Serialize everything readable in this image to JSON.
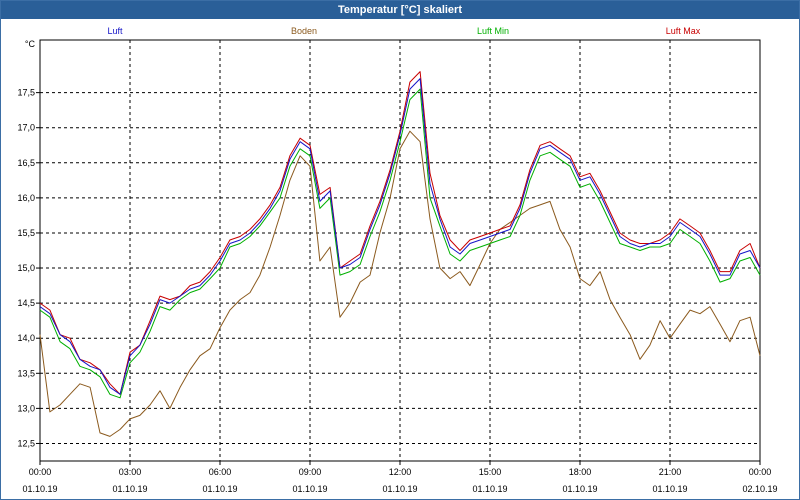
{
  "window": {
    "title": "Temperatur [°C] skaliert"
  },
  "colors": {
    "luft": "#1515c8",
    "boden": "#8b5a1e",
    "luft_min": "#00b000",
    "luft_max": "#c80000",
    "titlebar": "#2a5f98"
  },
  "chart_data": {
    "type": "line",
    "title": "Temperatur [°C] skaliert",
    "ylabel": "°C",
    "xlabel": "",
    "ylim": [
      12.25,
      18.25
    ],
    "yticks": [
      12.5,
      13.0,
      13.5,
      14.0,
      14.5,
      15.0,
      15.5,
      16.0,
      16.5,
      17.0,
      17.5
    ],
    "xlim": [
      0,
      24
    ],
    "xticks": [
      {
        "x": 0,
        "time": "00:00",
        "date": "01.10.19"
      },
      {
        "x": 3,
        "time": "03:00",
        "date": "01.10.19"
      },
      {
        "x": 6,
        "time": "06:00",
        "date": "01.10.19"
      },
      {
        "x": 9,
        "time": "09:00",
        "date": "01.10.19"
      },
      {
        "x": 12,
        "time": "12:00",
        "date": "01.10.19"
      },
      {
        "x": 15,
        "time": "15:00",
        "date": "01.10.19"
      },
      {
        "x": 18,
        "time": "18:00",
        "date": "01.10.19"
      },
      {
        "x": 21,
        "time": "21:00",
        "date": "01.10.19"
      },
      {
        "x": 24,
        "time": "00:00",
        "date": "02.10.19"
      }
    ],
    "grid": true,
    "legend_position": "top",
    "series": [
      {
        "name": "Luft",
        "color_key": "luft",
        "points": [
          [
            0,
            14.45
          ],
          [
            0.33,
            14.35
          ],
          [
            0.67,
            14.05
          ],
          [
            1.0,
            13.95
          ],
          [
            1.33,
            13.7
          ],
          [
            1.67,
            13.6
          ],
          [
            2.0,
            13.55
          ],
          [
            2.33,
            13.3
          ],
          [
            2.67,
            13.2
          ],
          [
            3.0,
            13.75
          ],
          [
            3.33,
            13.9
          ],
          [
            3.67,
            14.2
          ],
          [
            4.0,
            14.55
          ],
          [
            4.33,
            14.5
          ],
          [
            4.67,
            14.6
          ],
          [
            5.0,
            14.7
          ],
          [
            5.33,
            14.75
          ],
          [
            5.67,
            14.9
          ],
          [
            6.0,
            15.1
          ],
          [
            6.33,
            15.35
          ],
          [
            6.67,
            15.4
          ],
          [
            7.0,
            15.5
          ],
          [
            7.33,
            15.65
          ],
          [
            7.67,
            15.85
          ],
          [
            8.0,
            16.1
          ],
          [
            8.33,
            16.55
          ],
          [
            8.67,
            16.8
          ],
          [
            9.0,
            16.7
          ],
          [
            9.33,
            15.95
          ],
          [
            9.67,
            16.1
          ],
          [
            10.0,
            15.0
          ],
          [
            10.33,
            15.05
          ],
          [
            10.67,
            15.15
          ],
          [
            11.0,
            15.55
          ],
          [
            11.33,
            15.9
          ],
          [
            11.67,
            16.35
          ],
          [
            12.0,
            16.9
          ],
          [
            12.33,
            17.55
          ],
          [
            12.67,
            17.7
          ],
          [
            13.0,
            16.2
          ],
          [
            13.33,
            15.7
          ],
          [
            13.67,
            15.3
          ],
          [
            14.0,
            15.2
          ],
          [
            14.33,
            15.35
          ],
          [
            14.67,
            15.4
          ],
          [
            15.0,
            15.45
          ],
          [
            15.33,
            15.5
          ],
          [
            15.67,
            15.55
          ],
          [
            16.0,
            15.85
          ],
          [
            16.33,
            16.35
          ],
          [
            16.67,
            16.7
          ],
          [
            17.0,
            16.75
          ],
          [
            17.33,
            16.65
          ],
          [
            17.67,
            16.55
          ],
          [
            18.0,
            16.25
          ],
          [
            18.33,
            16.3
          ],
          [
            18.67,
            16.05
          ],
          [
            19.0,
            15.75
          ],
          [
            19.33,
            15.45
          ],
          [
            19.67,
            15.35
          ],
          [
            20.0,
            15.3
          ],
          [
            20.33,
            15.35
          ],
          [
            20.67,
            15.35
          ],
          [
            21.0,
            15.45
          ],
          [
            21.33,
            15.65
          ],
          [
            21.67,
            15.55
          ],
          [
            22.0,
            15.45
          ],
          [
            22.33,
            15.2
          ],
          [
            22.67,
            14.9
          ],
          [
            23.0,
            14.9
          ],
          [
            23.33,
            15.2
          ],
          [
            23.67,
            15.25
          ],
          [
            24.0,
            15.0
          ]
        ]
      },
      {
        "name": "Boden",
        "color_key": "boden",
        "points": [
          [
            0,
            14.05
          ],
          [
            0.33,
            12.95
          ],
          [
            0.67,
            13.05
          ],
          [
            1.0,
            13.2
          ],
          [
            1.33,
            13.35
          ],
          [
            1.67,
            13.3
          ],
          [
            2.0,
            12.65
          ],
          [
            2.33,
            12.6
          ],
          [
            2.67,
            12.7
          ],
          [
            3.0,
            12.85
          ],
          [
            3.33,
            12.9
          ],
          [
            3.67,
            13.05
          ],
          [
            4.0,
            13.25
          ],
          [
            4.33,
            13.0
          ],
          [
            4.67,
            13.3
          ],
          [
            5.0,
            13.55
          ],
          [
            5.33,
            13.75
          ],
          [
            5.67,
            13.85
          ],
          [
            6.0,
            14.15
          ],
          [
            6.33,
            14.4
          ],
          [
            6.67,
            14.55
          ],
          [
            7.0,
            14.65
          ],
          [
            7.33,
            14.9
          ],
          [
            7.67,
            15.3
          ],
          [
            8.0,
            15.75
          ],
          [
            8.33,
            16.25
          ],
          [
            8.67,
            16.6
          ],
          [
            9.0,
            16.45
          ],
          [
            9.33,
            15.1
          ],
          [
            9.67,
            15.3
          ],
          [
            10.0,
            14.3
          ],
          [
            10.33,
            14.5
          ],
          [
            10.67,
            14.8
          ],
          [
            11.0,
            14.9
          ],
          [
            11.33,
            15.5
          ],
          [
            11.67,
            16.0
          ],
          [
            12.0,
            16.7
          ],
          [
            12.33,
            16.95
          ],
          [
            12.67,
            16.8
          ],
          [
            13.0,
            15.7
          ],
          [
            13.33,
            15.0
          ],
          [
            13.67,
            14.85
          ],
          [
            14.0,
            14.95
          ],
          [
            14.33,
            14.75
          ],
          [
            14.67,
            15.05
          ],
          [
            15.0,
            15.35
          ],
          [
            15.33,
            15.55
          ],
          [
            15.67,
            15.65
          ],
          [
            16.0,
            15.75
          ],
          [
            16.33,
            15.85
          ],
          [
            16.67,
            15.9
          ],
          [
            17.0,
            15.95
          ],
          [
            17.33,
            15.55
          ],
          [
            17.67,
            15.3
          ],
          [
            18.0,
            14.85
          ],
          [
            18.33,
            14.75
          ],
          [
            18.67,
            14.95
          ],
          [
            19.0,
            14.55
          ],
          [
            19.33,
            14.3
          ],
          [
            19.67,
            14.05
          ],
          [
            20.0,
            13.7
          ],
          [
            20.33,
            13.9
          ],
          [
            20.67,
            14.25
          ],
          [
            21.0,
            14.0
          ],
          [
            21.33,
            14.2
          ],
          [
            21.67,
            14.4
          ],
          [
            22.0,
            14.35
          ],
          [
            22.33,
            14.45
          ],
          [
            22.67,
            14.2
          ],
          [
            23.0,
            13.95
          ],
          [
            23.33,
            14.25
          ],
          [
            23.67,
            14.3
          ],
          [
            24.0,
            13.75
          ]
        ]
      },
      {
        "name": "Luft Min",
        "color_key": "luft_min",
        "points": [
          [
            0,
            14.4
          ],
          [
            0.33,
            14.3
          ],
          [
            0.67,
            13.95
          ],
          [
            1.0,
            13.85
          ],
          [
            1.33,
            13.6
          ],
          [
            1.67,
            13.55
          ],
          [
            2.0,
            13.45
          ],
          [
            2.33,
            13.2
          ],
          [
            2.67,
            13.15
          ],
          [
            3.0,
            13.65
          ],
          [
            3.33,
            13.8
          ],
          [
            3.67,
            14.1
          ],
          [
            4.0,
            14.45
          ],
          [
            4.33,
            14.4
          ],
          [
            4.67,
            14.55
          ],
          [
            5.0,
            14.65
          ],
          [
            5.33,
            14.7
          ],
          [
            5.67,
            14.85
          ],
          [
            6.0,
            15.0
          ],
          [
            6.33,
            15.3
          ],
          [
            6.67,
            15.35
          ],
          [
            7.0,
            15.45
          ],
          [
            7.33,
            15.6
          ],
          [
            7.67,
            15.8
          ],
          [
            8.0,
            16.0
          ],
          [
            8.33,
            16.45
          ],
          [
            8.67,
            16.7
          ],
          [
            9.0,
            16.6
          ],
          [
            9.33,
            15.85
          ],
          [
            9.67,
            16.0
          ],
          [
            10.0,
            14.9
          ],
          [
            10.33,
            14.95
          ],
          [
            10.67,
            15.05
          ],
          [
            11.0,
            15.45
          ],
          [
            11.33,
            15.8
          ],
          [
            11.67,
            16.25
          ],
          [
            12.0,
            16.8
          ],
          [
            12.33,
            17.4
          ],
          [
            12.67,
            17.55
          ],
          [
            13.0,
            16.0
          ],
          [
            13.33,
            15.6
          ],
          [
            13.67,
            15.2
          ],
          [
            14.0,
            15.1
          ],
          [
            14.33,
            15.25
          ],
          [
            14.67,
            15.3
          ],
          [
            15.0,
            15.35
          ],
          [
            15.33,
            15.4
          ],
          [
            15.67,
            15.45
          ],
          [
            16.0,
            15.75
          ],
          [
            16.33,
            16.25
          ],
          [
            16.67,
            16.6
          ],
          [
            17.0,
            16.65
          ],
          [
            17.33,
            16.55
          ],
          [
            17.67,
            16.45
          ],
          [
            18.0,
            16.15
          ],
          [
            18.33,
            16.2
          ],
          [
            18.67,
            15.95
          ],
          [
            19.0,
            15.65
          ],
          [
            19.33,
            15.35
          ],
          [
            19.67,
            15.3
          ],
          [
            20.0,
            15.25
          ],
          [
            20.33,
            15.3
          ],
          [
            20.67,
            15.3
          ],
          [
            21.0,
            15.35
          ],
          [
            21.33,
            15.55
          ],
          [
            21.67,
            15.45
          ],
          [
            22.0,
            15.35
          ],
          [
            22.33,
            15.1
          ],
          [
            22.67,
            14.8
          ],
          [
            23.0,
            14.85
          ],
          [
            23.33,
            15.1
          ],
          [
            23.67,
            15.15
          ],
          [
            24.0,
            14.9
          ]
        ]
      },
      {
        "name": "Luft Max",
        "color_key": "luft_max",
        "points": [
          [
            0,
            14.5
          ],
          [
            0.33,
            14.4
          ],
          [
            0.67,
            14.05
          ],
          [
            1.0,
            14.0
          ],
          [
            1.33,
            13.7
          ],
          [
            1.67,
            13.65
          ],
          [
            2.0,
            13.55
          ],
          [
            2.33,
            13.35
          ],
          [
            2.67,
            13.2
          ],
          [
            3.0,
            13.8
          ],
          [
            3.33,
            13.9
          ],
          [
            3.67,
            14.25
          ],
          [
            4.0,
            14.6
          ],
          [
            4.33,
            14.55
          ],
          [
            4.67,
            14.6
          ],
          [
            5.0,
            14.75
          ],
          [
            5.33,
            14.8
          ],
          [
            5.67,
            14.95
          ],
          [
            6.0,
            15.15
          ],
          [
            6.33,
            15.4
          ],
          [
            6.67,
            15.45
          ],
          [
            7.0,
            15.55
          ],
          [
            7.33,
            15.7
          ],
          [
            7.67,
            15.9
          ],
          [
            8.0,
            16.15
          ],
          [
            8.33,
            16.6
          ],
          [
            8.67,
            16.85
          ],
          [
            9.0,
            16.75
          ],
          [
            9.33,
            16.05
          ],
          [
            9.67,
            16.15
          ],
          [
            10.0,
            15.0
          ],
          [
            10.33,
            15.1
          ],
          [
            10.67,
            15.2
          ],
          [
            11.0,
            15.6
          ],
          [
            11.33,
            15.95
          ],
          [
            11.67,
            16.4
          ],
          [
            12.0,
            16.95
          ],
          [
            12.33,
            17.65
          ],
          [
            12.67,
            17.8
          ],
          [
            13.0,
            16.35
          ],
          [
            13.33,
            15.75
          ],
          [
            13.67,
            15.4
          ],
          [
            14.0,
            15.25
          ],
          [
            14.33,
            15.4
          ],
          [
            14.67,
            15.45
          ],
          [
            15.0,
            15.5
          ],
          [
            15.33,
            15.55
          ],
          [
            15.67,
            15.6
          ],
          [
            16.0,
            15.9
          ],
          [
            16.33,
            16.4
          ],
          [
            16.67,
            16.75
          ],
          [
            17.0,
            16.8
          ],
          [
            17.33,
            16.7
          ],
          [
            17.67,
            16.6
          ],
          [
            18.0,
            16.3
          ],
          [
            18.33,
            16.35
          ],
          [
            18.67,
            16.1
          ],
          [
            19.0,
            15.8
          ],
          [
            19.33,
            15.5
          ],
          [
            19.67,
            15.4
          ],
          [
            20.0,
            15.35
          ],
          [
            20.33,
            15.35
          ],
          [
            20.67,
            15.4
          ],
          [
            21.0,
            15.5
          ],
          [
            21.33,
            15.7
          ],
          [
            21.67,
            15.6
          ],
          [
            22.0,
            15.5
          ],
          [
            22.33,
            15.25
          ],
          [
            22.67,
            14.95
          ],
          [
            23.0,
            14.95
          ],
          [
            23.33,
            15.25
          ],
          [
            23.67,
            15.35
          ],
          [
            24.0,
            15.0
          ]
        ]
      }
    ]
  }
}
